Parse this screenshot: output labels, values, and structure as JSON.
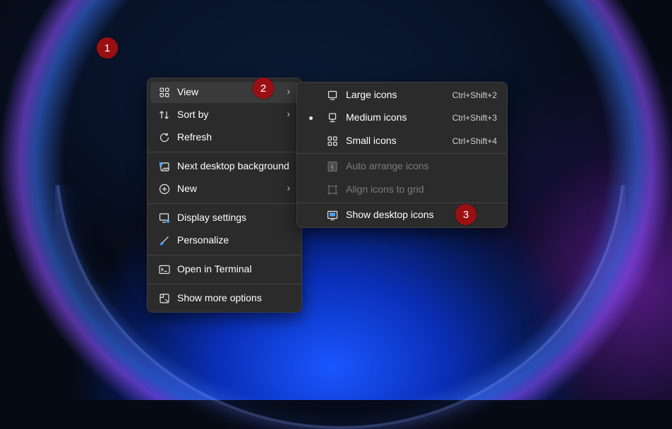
{
  "markers": [
    "1",
    "2",
    "3"
  ],
  "context_menu": {
    "items": [
      {
        "label": "View",
        "icon": "grid-icon",
        "has_submenu": true
      },
      {
        "label": "Sort by",
        "icon": "sort-icon",
        "has_submenu": true
      },
      {
        "label": "Refresh",
        "icon": "refresh-icon",
        "has_submenu": false
      },
      {
        "label": "Next desktop background",
        "icon": "next-background-icon",
        "has_submenu": false
      },
      {
        "label": "New",
        "icon": "plus-circle-icon",
        "has_submenu": true
      },
      {
        "label": "Display settings",
        "icon": "display-settings-icon",
        "has_submenu": false
      },
      {
        "label": "Personalize",
        "icon": "brush-icon",
        "has_submenu": false
      },
      {
        "label": "Open in Terminal",
        "icon": "terminal-icon",
        "has_submenu": false
      },
      {
        "label": "Show more options",
        "icon": "more-options-icon",
        "has_submenu": false
      }
    ]
  },
  "view_submenu": {
    "items": [
      {
        "label": "Large icons",
        "shortcut": "Ctrl+Shift+2",
        "icon": "monitor-icon",
        "selected": false,
        "enabled": true
      },
      {
        "label": "Medium icons",
        "shortcut": "Ctrl+Shift+3",
        "icon": "monitor-stand-icon",
        "selected": true,
        "enabled": true
      },
      {
        "label": "Small icons",
        "shortcut": "Ctrl+Shift+4",
        "icon": "grid-icon",
        "selected": false,
        "enabled": true
      },
      {
        "label": "Auto arrange icons",
        "shortcut": "",
        "icon": "auto-arrange-icon",
        "selected": false,
        "enabled": false
      },
      {
        "label": "Align icons to grid",
        "shortcut": "",
        "icon": "align-grid-icon",
        "selected": false,
        "enabled": false
      },
      {
        "label": "Show desktop icons",
        "shortcut": "",
        "icon": "show-desktop-icon",
        "selected": false,
        "enabled": true
      }
    ]
  },
  "colors": {
    "menu_bg": "#2b2b2b",
    "marker": "#9a0f12",
    "disabled_text": "#7c7c7c"
  }
}
